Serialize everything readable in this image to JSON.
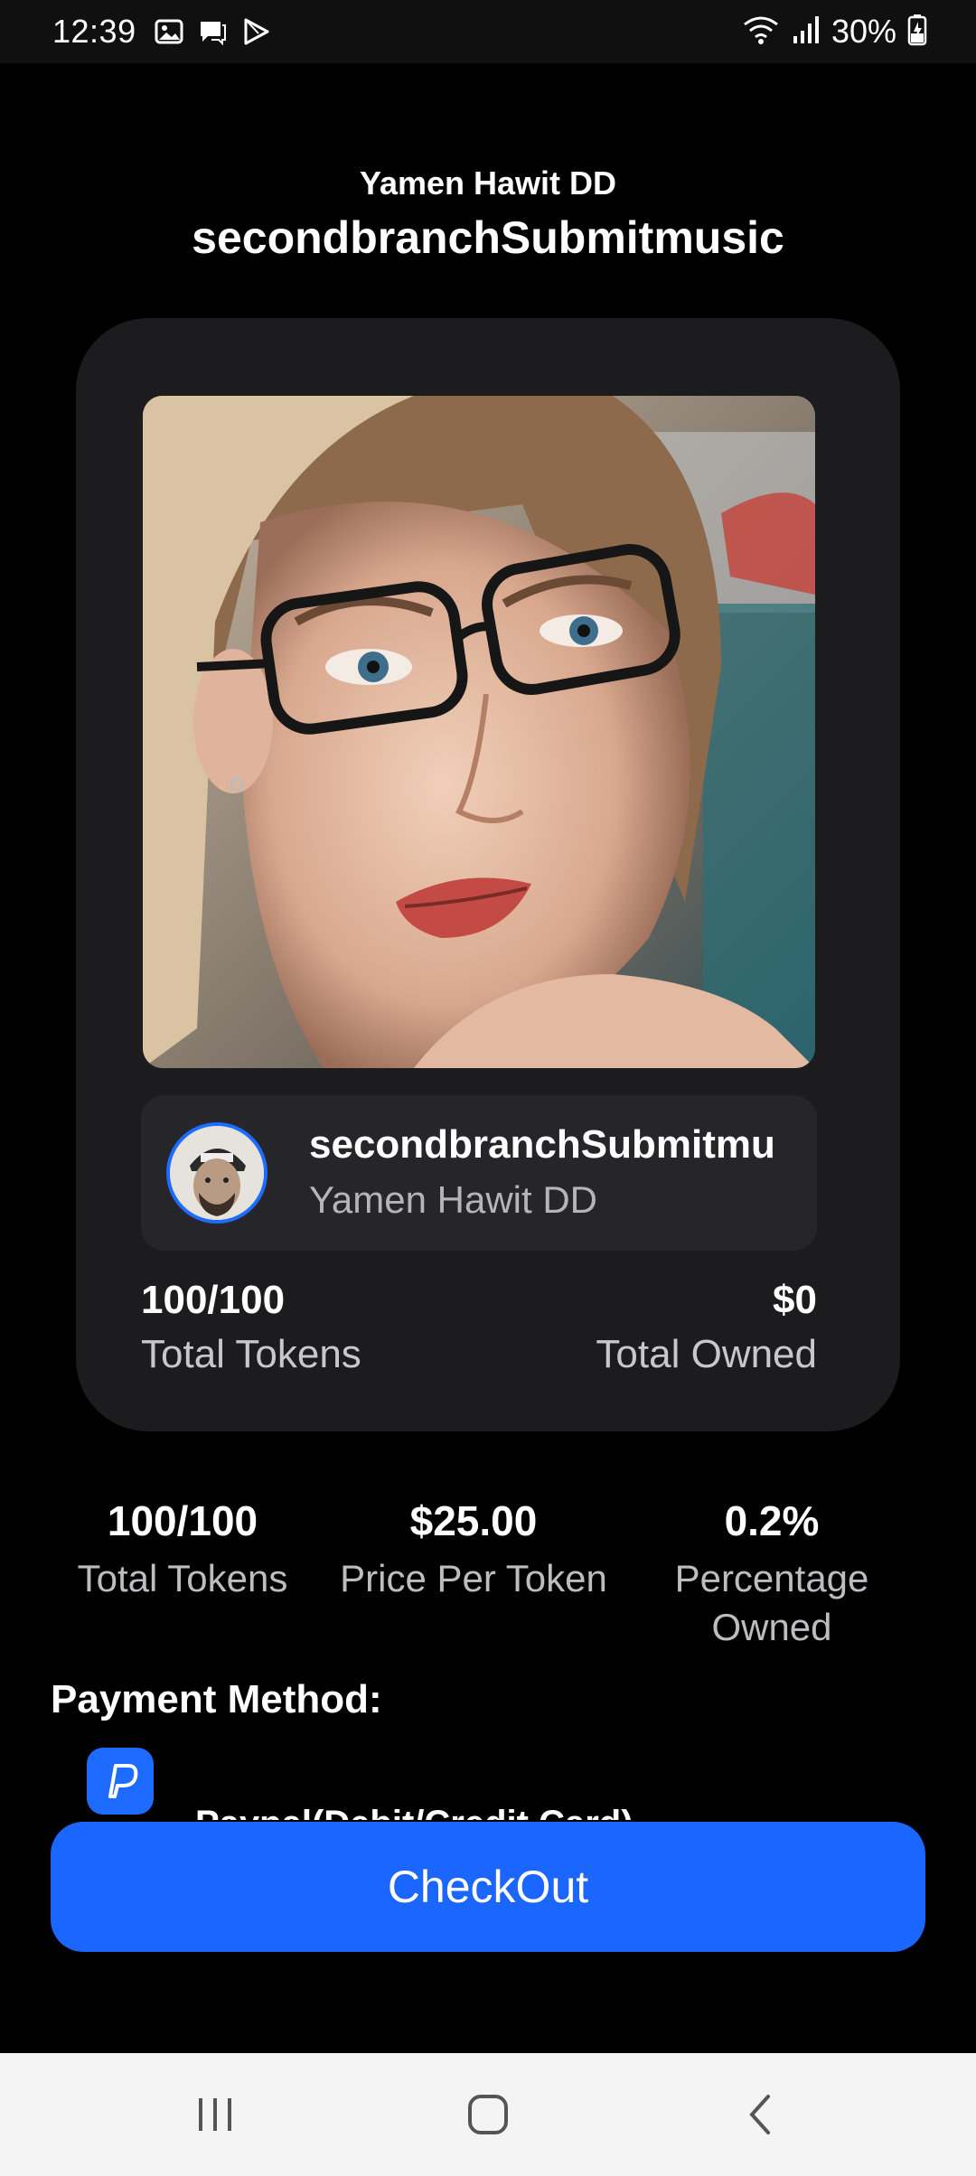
{
  "status_bar": {
    "time": "12:39",
    "battery": "30%",
    "icons_left": [
      "image-icon",
      "message-icon",
      "play-store-icon"
    ],
    "icons_right": [
      "wifi-icon",
      "signal-icon",
      "battery-charging-icon"
    ]
  },
  "header": {
    "subtitle": "Yamen Hawit DD",
    "title": "secondbranchSubmitmusic"
  },
  "card": {
    "owner_title": "secondbranchSubmitmu",
    "owner_subtitle": "Yamen Hawit DD",
    "left_value": "100/100",
    "left_label": "Total Tokens",
    "right_value": "$0",
    "right_label": "Total Owned"
  },
  "stats": [
    {
      "value": "100/100",
      "label": "Total Tokens"
    },
    {
      "value": "$25.00",
      "label": "Price Per Token"
    },
    {
      "value": "0.2%",
      "label": "Percentage Owned"
    }
  ],
  "payment": {
    "heading": "Payment Method:",
    "option_label": "Paypal(Debit/Credit Card)"
  },
  "checkout": {
    "label": "CheckOut"
  },
  "colors": {
    "accent": "#1a66ff",
    "card": "#1c1c1e",
    "background": "#000000"
  }
}
